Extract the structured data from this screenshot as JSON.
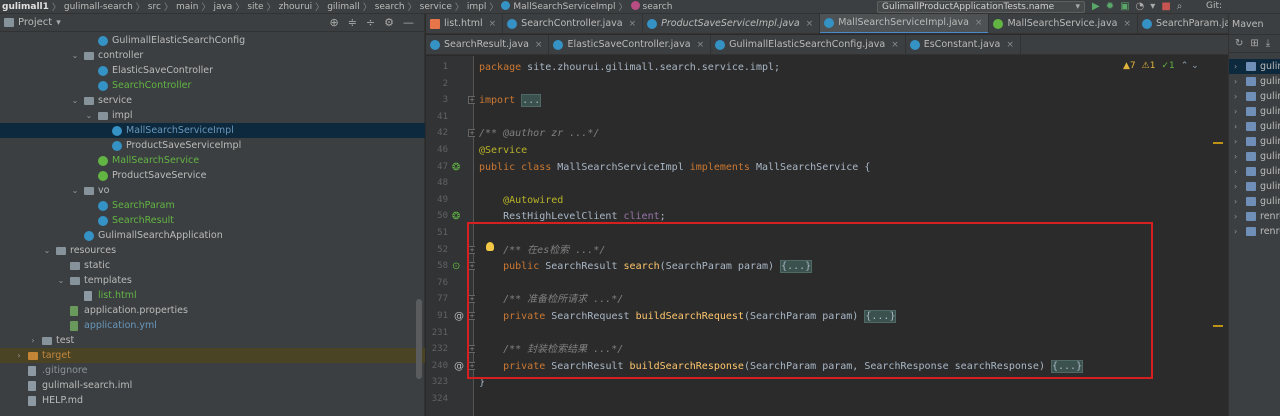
{
  "breadcrumb": [
    {
      "text": "gulimall1",
      "icon": ""
    },
    {
      "text": "gulimall-search",
      "icon": ""
    },
    {
      "text": "src",
      "icon": ""
    },
    {
      "text": "main",
      "icon": ""
    },
    {
      "text": "java",
      "icon": ""
    },
    {
      "text": "site",
      "icon": ""
    },
    {
      "text": "zhourui",
      "icon": ""
    },
    {
      "text": "gilimall",
      "icon": ""
    },
    {
      "text": "search",
      "icon": ""
    },
    {
      "text": "service",
      "icon": ""
    },
    {
      "text": "impl",
      "icon": ""
    },
    {
      "text": "MallSearchServiceImpl",
      "icon": "class"
    },
    {
      "text": "search",
      "icon": "method"
    }
  ],
  "breadcrumb_sep": "〉",
  "run_config": {
    "label": "GulimallProductApplicationTests.name",
    "arrow": "▾"
  },
  "run_buttons": [
    {
      "name": "run-icon",
      "glyph": "▶",
      "color": "#59a869"
    },
    {
      "name": "debug-icon",
      "glyph": "✹",
      "color": "#59a869"
    },
    {
      "name": "coverage-icon",
      "glyph": "▣",
      "color": "#59a869"
    },
    {
      "name": "profile-icon",
      "glyph": "◔",
      "color": "#aaaaaa"
    },
    {
      "name": "build-icon",
      "glyph": "▾",
      "color": "#aaaaaa"
    },
    {
      "name": "stop-icon",
      "glyph": "■",
      "color": "#c75450"
    },
    {
      "name": "search-everywhere-icon",
      "glyph": "⌕",
      "color": "#aaaaaa"
    }
  ],
  "git_label": "Git:",
  "project_panel": {
    "title": "Project",
    "dropdown": "▾",
    "tools": [
      {
        "name": "locate-icon",
        "glyph": "⊕"
      },
      {
        "name": "collapse-all-icon",
        "glyph": "≑"
      },
      {
        "name": "expand-icon",
        "glyph": "÷"
      },
      {
        "name": "gear-icon",
        "glyph": "⚙"
      },
      {
        "name": "hide-icon",
        "glyph": "—"
      }
    ]
  },
  "tree": [
    {
      "indent": 7,
      "chev": "",
      "icon": "class",
      "label": "GulimallElasticSearchConfig",
      "color": "c-def",
      "state": ""
    },
    {
      "indent": 6,
      "chev": "⌄",
      "icon": "folder",
      "label": "controller",
      "color": "c-def",
      "state": ""
    },
    {
      "indent": 7,
      "chev": "",
      "icon": "class",
      "label": "ElasticSaveController",
      "color": "c-def",
      "state": ""
    },
    {
      "indent": 7,
      "chev": "",
      "icon": "class",
      "label": "SearchController",
      "color": "c-green",
      "state": ""
    },
    {
      "indent": 6,
      "chev": "⌄",
      "icon": "folder",
      "label": "service",
      "color": "c-def",
      "state": ""
    },
    {
      "indent": 7,
      "chev": "⌄",
      "icon": "folder",
      "label": "impl",
      "color": "c-def",
      "state": ""
    },
    {
      "indent": 8,
      "chev": "",
      "icon": "class",
      "label": "MallSearchServiceImpl",
      "color": "c-blue",
      "state": "selected"
    },
    {
      "indent": 8,
      "chev": "",
      "icon": "class",
      "label": "ProductSaveServiceImpl",
      "color": "c-def",
      "state": ""
    },
    {
      "indent": 7,
      "chev": "",
      "icon": "iface",
      "label": "MallSearchService",
      "color": "c-green",
      "state": ""
    },
    {
      "indent": 7,
      "chev": "",
      "icon": "iface",
      "label": "ProductSaveService",
      "color": "c-def",
      "state": ""
    },
    {
      "indent": 6,
      "chev": "⌄",
      "icon": "folder",
      "label": "vo",
      "color": "c-def",
      "state": ""
    },
    {
      "indent": 7,
      "chev": "",
      "icon": "class",
      "label": "SearchParam",
      "color": "c-green",
      "state": ""
    },
    {
      "indent": 7,
      "chev": "",
      "icon": "class",
      "label": "SearchResult",
      "color": "c-green",
      "state": ""
    },
    {
      "indent": 6,
      "chev": "",
      "icon": "class",
      "label": "GulimallSearchApplication",
      "color": "c-def",
      "state": ""
    },
    {
      "indent": 4,
      "chev": "⌄",
      "icon": "folder",
      "label": "resources",
      "color": "c-def",
      "state": ""
    },
    {
      "indent": 5,
      "chev": "",
      "icon": "folder",
      "label": "static",
      "color": "c-def",
      "state": ""
    },
    {
      "indent": 5,
      "chev": "⌄",
      "icon": "folder",
      "label": "templates",
      "color": "c-def",
      "state": ""
    },
    {
      "indent": 6,
      "chev": "",
      "icon": "file",
      "label": "list.html",
      "color": "c-green",
      "state": ""
    },
    {
      "indent": 5,
      "chev": "",
      "icon": "prop",
      "label": "application.properties",
      "color": "c-def",
      "state": ""
    },
    {
      "indent": 5,
      "chev": "",
      "icon": "prop",
      "label": "application.yml",
      "color": "c-blue",
      "state": ""
    },
    {
      "indent": 3,
      "chev": "›",
      "icon": "folder",
      "label": "test",
      "color": "c-def",
      "state": ""
    },
    {
      "indent": 2,
      "chev": "›",
      "icon": "folder-o",
      "label": "target",
      "color": "c-orange",
      "state": "hl"
    },
    {
      "indent": 2,
      "chev": "",
      "icon": "file",
      "label": ".gitignore",
      "color": "c-git",
      "state": ""
    },
    {
      "indent": 2,
      "chev": "",
      "icon": "file",
      "label": "gulimall-search.iml",
      "color": "c-def",
      "state": ""
    },
    {
      "indent": 2,
      "chev": "",
      "icon": "file",
      "label": "HELP.md",
      "color": "c-def",
      "state": ""
    }
  ],
  "tabs_row1": [
    {
      "label": "list.html",
      "icon": "html",
      "style": "",
      "close": "×"
    },
    {
      "label": "SearchController.java",
      "icon": "class",
      "style": "",
      "close": "×"
    },
    {
      "label": "ProductSaveServiceImpl.java",
      "icon": "class",
      "style": "italic",
      "close": "×"
    },
    {
      "label": "MallSearchServiceImpl.java",
      "icon": "class",
      "style": "active",
      "close": "×"
    },
    {
      "label": "MallSearchService.java",
      "icon": "iface",
      "style": "",
      "close": "×"
    },
    {
      "label": "SearchParam.java",
      "icon": "class",
      "style": "",
      "close": "×"
    }
  ],
  "tabs_row2": [
    {
      "label": "SearchResult.java",
      "icon": "class",
      "style": "",
      "close": "×"
    },
    {
      "label": "ElasticSaveController.java",
      "icon": "class",
      "style": "",
      "close": "×"
    },
    {
      "label": "GulimallElasticSearchConfig.java",
      "icon": "class",
      "style": "",
      "close": "×"
    },
    {
      "label": "EsConstant.java",
      "icon": "class",
      "style": "",
      "close": "×"
    }
  ],
  "inspections": {
    "warnings": "▲7",
    "weak": "⚠1",
    "ok": "✓1",
    "nav": "⌃ ⌄"
  },
  "code_lines": [
    {
      "num": "1",
      "tokens": [
        {
          "c": "kw",
          "t": "package "
        },
        {
          "c": "plain",
          "t": "site.zhourui.gilimall.search.service.impl;"
        }
      ]
    },
    {
      "num": "2",
      "tokens": []
    },
    {
      "num": "3",
      "tokens": [
        {
          "c": "kw",
          "t": "import "
        },
        {
          "c": "fe",
          "t": "..."
        }
      ]
    },
    {
      "num": "41",
      "tokens": []
    },
    {
      "num": "42",
      "tokens": [
        {
          "c": "cm",
          "t": "/** @author zr ...*/"
        }
      ]
    },
    {
      "num": "46",
      "tokens": [
        {
          "c": "an",
          "t": "@Service"
        }
      ]
    },
    {
      "num": "47",
      "tokens": [
        {
          "c": "kw",
          "t": "public class "
        },
        {
          "c": "ty",
          "t": "MallSearchServiceImpl "
        },
        {
          "c": "kw",
          "t": "implements "
        },
        {
          "c": "ty",
          "t": "MallSearchService {"
        }
      ]
    },
    {
      "num": "48",
      "tokens": []
    },
    {
      "num": "49",
      "tokens": [
        {
          "c": "plain",
          "t": "    "
        },
        {
          "c": "an",
          "t": "@Autowired"
        }
      ]
    },
    {
      "num": "50",
      "tokens": [
        {
          "c": "plain",
          "t": "    RestHighLevelClient "
        },
        {
          "c": "fld",
          "t": "client"
        },
        {
          "c": "plain",
          "t": ";"
        }
      ]
    },
    {
      "num": "51",
      "tokens": []
    },
    {
      "num": "52",
      "tokens": [
        {
          "c": "plain",
          "t": "    "
        },
        {
          "c": "cm",
          "t": "/** 在es检索 ...*/"
        }
      ]
    },
    {
      "num": "58",
      "tokens": [
        {
          "c": "plain",
          "t": "    "
        },
        {
          "c": "kw",
          "t": "public "
        },
        {
          "c": "ty",
          "t": "SearchResult "
        },
        {
          "c": "fn",
          "t": "search"
        },
        {
          "c": "plain",
          "t": "(SearchParam param) "
        },
        {
          "c": "fe",
          "t": "{...}"
        }
      ]
    },
    {
      "num": "76",
      "tokens": []
    },
    {
      "num": "77",
      "tokens": [
        {
          "c": "plain",
          "t": "    "
        },
        {
          "c": "cm",
          "t": "/** 准备检所请求 ...*/"
        }
      ]
    },
    {
      "num": "91",
      "tokens": [
        {
          "c": "plain",
          "t": "    "
        },
        {
          "c": "kw",
          "t": "private "
        },
        {
          "c": "ty",
          "t": "SearchRequest "
        },
        {
          "c": "fn",
          "t": "buildSearchRequest"
        },
        {
          "c": "plain",
          "t": "(SearchParam param) "
        },
        {
          "c": "fe",
          "t": "{...}"
        }
      ]
    },
    {
      "num": "231",
      "tokens": []
    },
    {
      "num": "232",
      "tokens": [
        {
          "c": "plain",
          "t": "    "
        },
        {
          "c": "cm",
          "t": "/** 封装检索结果 ...*/"
        }
      ]
    },
    {
      "num": "240",
      "tokens": [
        {
          "c": "plain",
          "t": "    "
        },
        {
          "c": "kw",
          "t": "private "
        },
        {
          "c": "ty",
          "t": "SearchResult "
        },
        {
          "c": "fn",
          "t": "buildSearchResponse"
        },
        {
          "c": "plain",
          "t": "(SearchParam param, SearchResponse searchResponse) "
        },
        {
          "c": "fe",
          "t": "{...}"
        }
      ]
    },
    {
      "num": "323",
      "tokens": [
        {
          "c": "plain",
          "t": "}"
        }
      ]
    },
    {
      "num": "324",
      "tokens": []
    }
  ],
  "maven": {
    "title": "Maven",
    "tools": [
      {
        "name": "reload-icon",
        "glyph": "↻"
      },
      {
        "name": "add-icon",
        "glyph": "⊞"
      },
      {
        "name": "download-icon",
        "glyph": "⤓"
      }
    ],
    "items": [
      {
        "label": "gulimall",
        "state": "sel"
      },
      {
        "label": "gulimall",
        "state": ""
      },
      {
        "label": "gulimall",
        "state": ""
      },
      {
        "label": "gulimall",
        "state": ""
      },
      {
        "label": "gulimall",
        "state": ""
      },
      {
        "label": "gulimall",
        "state": ""
      },
      {
        "label": "gulimall",
        "state": ""
      },
      {
        "label": "gulimall",
        "state": ""
      },
      {
        "label": "gulimall",
        "state": ""
      },
      {
        "label": "gulimall",
        "state": ""
      },
      {
        "label": "renren",
        "state": ""
      },
      {
        "label": "renren",
        "state": ""
      }
    ]
  }
}
